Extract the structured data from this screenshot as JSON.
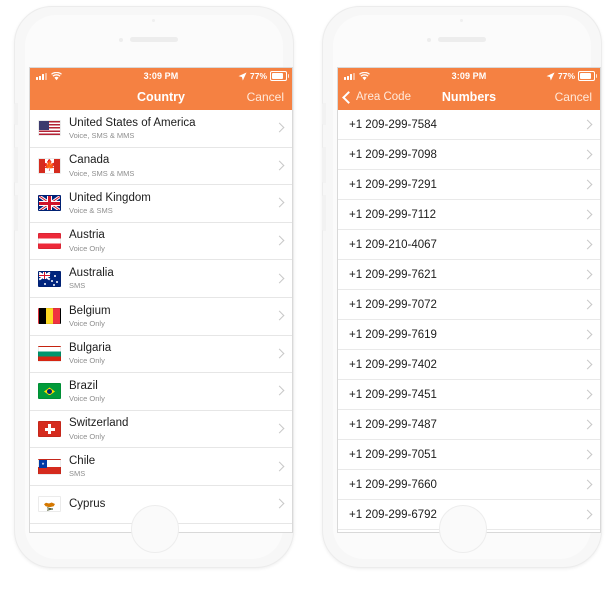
{
  "phones": [
    {
      "id": "country-picker",
      "statusbar": {
        "time": "3:09 PM",
        "battery_percent": "77%",
        "signal_icon": "signal-bars-icon",
        "wifi_icon": "wifi-icon",
        "location_icon": "location-arrow-icon",
        "battery_icon": "battery-icon"
      },
      "navbar": {
        "title": "Country",
        "right_label": "Cancel",
        "back_label": null
      },
      "rows": [
        {
          "name": "United States of America",
          "sub": "Voice, SMS & MMS",
          "flag": "f-us"
        },
        {
          "name": "Canada",
          "sub": "Voice, SMS & MMS",
          "flag": "f-ca"
        },
        {
          "name": "United Kingdom",
          "sub": "Voice & SMS",
          "flag": "f-uk"
        },
        {
          "name": "Austria",
          "sub": "Voice Only",
          "flag": "f-at"
        },
        {
          "name": "Australia",
          "sub": "SMS",
          "flag": "f-au"
        },
        {
          "name": "Belgium",
          "sub": "Voice Only",
          "flag": "f-be"
        },
        {
          "name": "Bulgaria",
          "sub": "Voice Only",
          "flag": "f-bg"
        },
        {
          "name": "Brazil",
          "sub": "Voice Only",
          "flag": "f-br"
        },
        {
          "name": "Switzerland",
          "sub": "Voice Only",
          "flag": "f-ch"
        },
        {
          "name": "Chile",
          "sub": "SMS",
          "flag": "f-cl"
        },
        {
          "name": "Cyprus",
          "sub": "",
          "flag": "f-cy"
        }
      ]
    },
    {
      "id": "numbers-picker",
      "statusbar": {
        "time": "3:09 PM",
        "battery_percent": "77%",
        "signal_icon": "signal-bars-icon",
        "wifi_icon": "wifi-icon",
        "location_icon": "location-arrow-icon",
        "battery_icon": "battery-icon"
      },
      "navbar": {
        "title": "Numbers",
        "right_label": "Cancel",
        "back_label": "Area Code"
      },
      "numbers": [
        "+1 209-299-7584",
        "+1 209-299-7098",
        "+1 209-299-7291",
        "+1 209-299-7112",
        "+1 209-210-4067",
        "+1 209-299-7621",
        "+1 209-299-7072",
        "+1 209-299-7619",
        "+1 209-299-7402",
        "+1 209-299-7451",
        "+1 209-299-7487",
        "+1 209-299-7051",
        "+1 209-299-7660",
        "+1 209-299-6792"
      ]
    }
  ],
  "colors": {
    "accent_orange": "#F58142",
    "row_separator": "#e6e6e6",
    "primary_text": "#1c1c1c",
    "secondary_text": "#8e8e8e",
    "chevron": "#c8c8c8"
  }
}
